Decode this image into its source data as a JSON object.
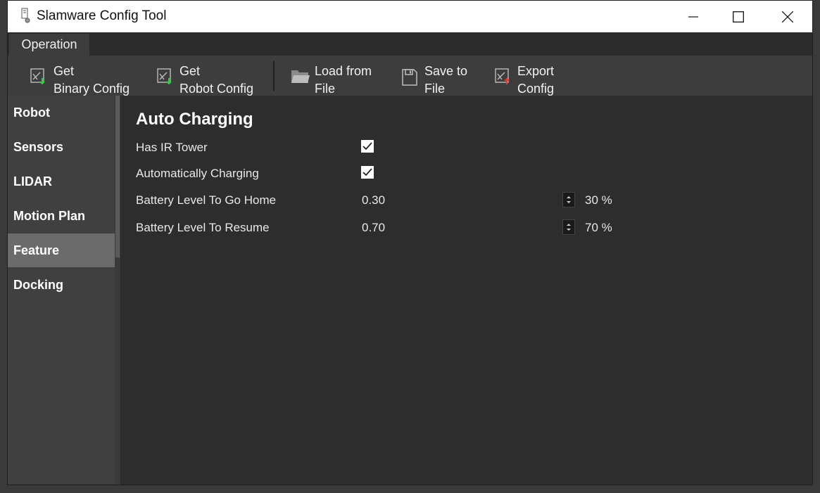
{
  "window": {
    "title": "Slamware Config Tool"
  },
  "menu": {
    "items": [
      {
        "label": "Operation"
      }
    ]
  },
  "toolbar": {
    "buttons": [
      {
        "label": "Get\nBinary Config",
        "icon": "download-config-icon"
      },
      {
        "label": "Get\nRobot Config",
        "icon": "download-config-icon"
      },
      {
        "label": "Load from\nFile",
        "icon": "folder-icon"
      },
      {
        "label": "Save to\nFile",
        "icon": "floppy-disk-icon"
      },
      {
        "label": "Export\nConfig",
        "icon": "upload-config-icon"
      }
    ]
  },
  "sidebar": {
    "items": [
      {
        "label": "Robot"
      },
      {
        "label": "Sensors"
      },
      {
        "label": "LIDAR"
      },
      {
        "label": "Motion Plan"
      },
      {
        "label": "Feature",
        "active": true
      },
      {
        "label": "Docking"
      }
    ]
  },
  "content": {
    "title": "Auto Charging",
    "has_ir_tower": {
      "label": "Has IR Tower",
      "checked": true
    },
    "auto_charging": {
      "label": "Automatically Charging",
      "checked": true
    },
    "go_home": {
      "label": "Battery Level To Go Home",
      "value": "0.30",
      "percent": "30 %"
    },
    "resume": {
      "label": "Battery Level To Resume",
      "value": "0.70",
      "percent": "70 %"
    }
  },
  "colors": {
    "accent_download": "#2ecc40",
    "accent_upload": "#e53935"
  }
}
